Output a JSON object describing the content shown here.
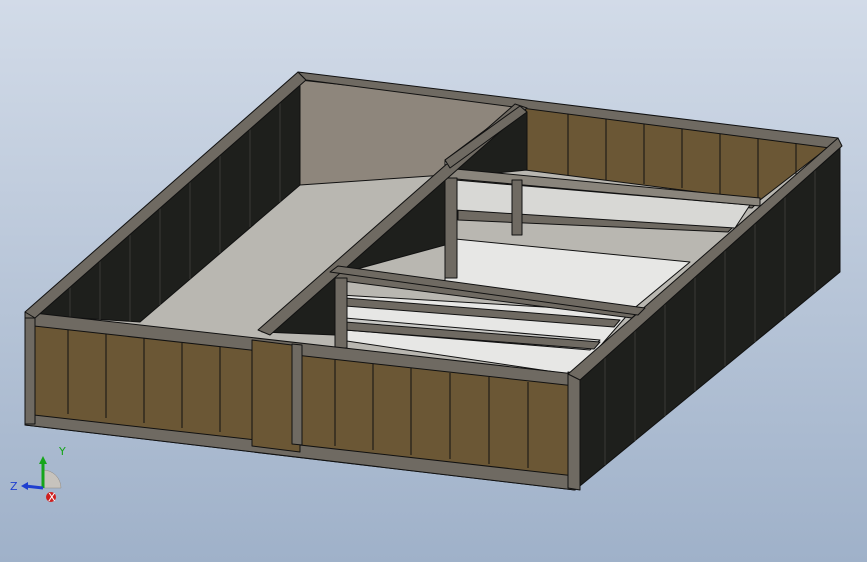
{
  "viewport": {
    "colors": {
      "bg_top": "#d2dbe8",
      "bg_bottom": "#9fb1c9",
      "frame": "#6f6a62",
      "frame_dark": "#4a463f",
      "panel_brown": "#6b5735",
      "panel_dark": "#1e1f1c",
      "floor": "#b9b7b1",
      "back_wall": "#8e867c",
      "shelf_light": "#e7e7e5",
      "shelf_mid": "#c9c9c6",
      "outline": "#111111"
    }
  },
  "triad": {
    "y_label": "Y",
    "z_label": "Z",
    "x_label": "X",
    "colors": {
      "y": "#15a51a",
      "z": "#1f3fd0",
      "x": "#d01f1f"
    }
  }
}
